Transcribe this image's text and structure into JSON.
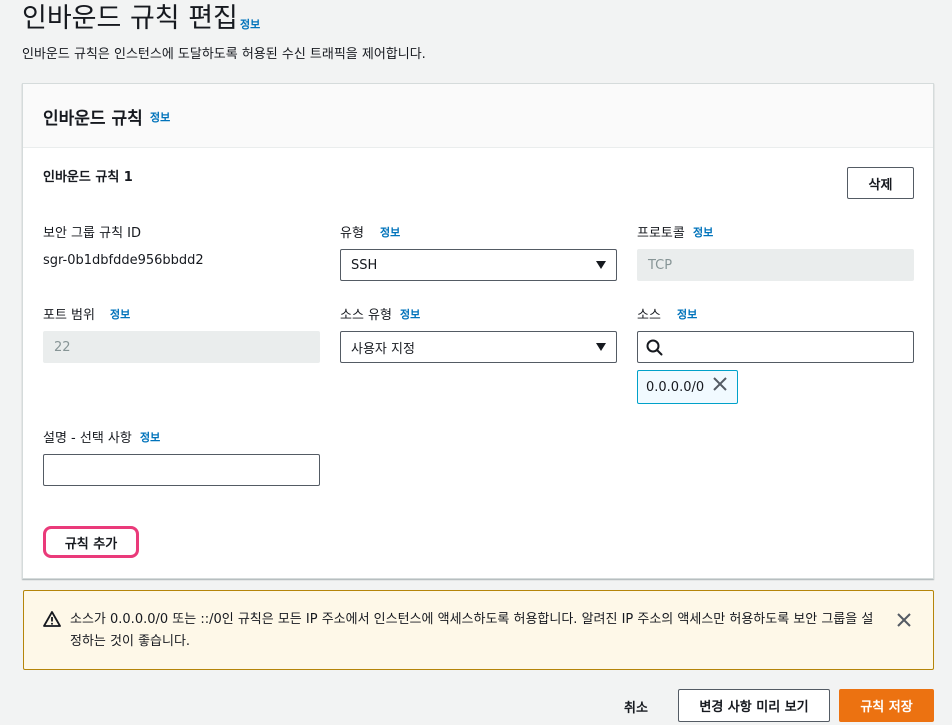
{
  "page": {
    "title": "인바운드 규칙 편집",
    "info": "정보",
    "description": "인바운드 규칙은 인스턴스에 도달하도록 허용된 수신 트래픽을 제어합니다."
  },
  "panel": {
    "title": "인바운드 규칙",
    "info": "정보",
    "rule": {
      "title": "인바운드 규칙 1",
      "delete_label": "삭제",
      "rule_id_label": "보안 그룹 규칙 ID",
      "rule_id_value": "sgr-0b1dbfdde956bbdd2",
      "type_label": "유형",
      "type_info": "정보",
      "type_value": "SSH",
      "protocol_label": "프로토콜",
      "protocol_info": "정보",
      "protocol_value": "TCP",
      "port_label": "포트 범위",
      "port_info": "정보",
      "port_value": "22",
      "source_type_label": "소스 유형",
      "source_type_info": "정보",
      "source_type_value": "사용자 지정",
      "source_label": "소스",
      "source_info": "정보",
      "source_search_value": "",
      "source_token": "0.0.0.0/0",
      "desc_label": "설명 - 선택 사항",
      "desc_info": "정보",
      "desc_value": ""
    },
    "add_rule_label": "규칙 추가"
  },
  "alert": {
    "line1": "소스가 0.0.0.0/0 또는 ::/0인 규칙은 모든 IP 주소에서 인스턴스에 액세스하도록 허용합니다. 알려진 IP 주소의 액세스만 허용하도록 보안 그룹을 설",
    "line2": "정하는 것이 좋습니다."
  },
  "footer": {
    "cancel_label": "취소",
    "preview_label": "변경 사항 미리 보기",
    "save_label": "규칙 저장"
  },
  "colors": {
    "primary": "#ec7211",
    "link": "#0073bb",
    "highlight": "#ea3a7a",
    "warning_bg": "#fef8e8",
    "warning_border": "#b5850a"
  },
  "icons": [
    "warning-icon",
    "close-icon",
    "search-icon",
    "caret-down-icon",
    "token-remove-icon"
  ]
}
